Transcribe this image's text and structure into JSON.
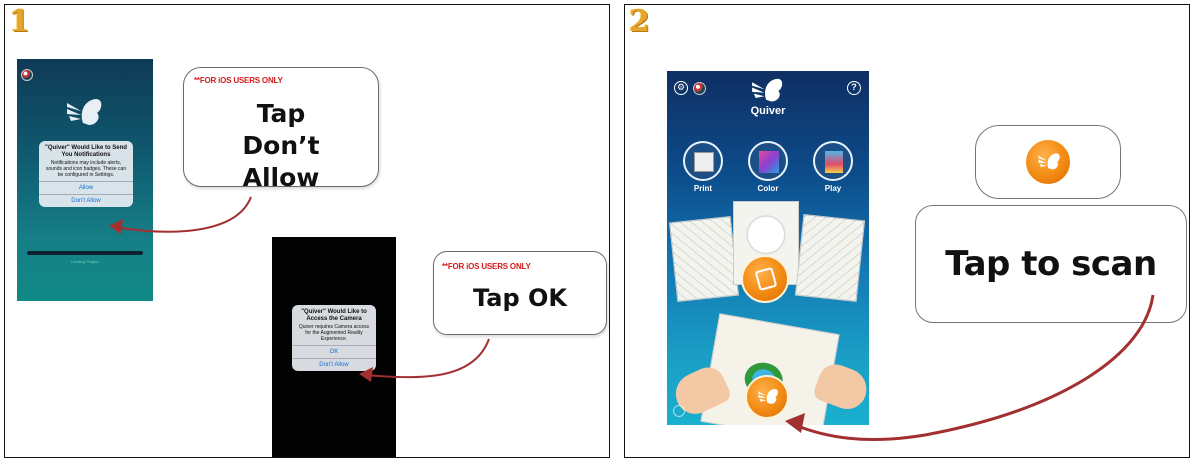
{
  "panel1": {
    "step_number": "1",
    "phone_notification": {
      "dialog_title": "\"Quiver\" Would Like to Send You Notifications",
      "dialog_body": "Notifications may include alerts, sounds and icon badges. These can be configured in Settings.",
      "allow_button": "Allow",
      "dont_allow_button": "Don't Allow",
      "loading_text": "Loading Plugins"
    },
    "callout_notifications": {
      "note": "**FOR iOS USERS ONLY",
      "instruction": "Tap Don’t Allow"
    },
    "phone_camera": {
      "dialog_title": "\"Quiver\" Would Like to Access the Camera",
      "dialog_body": "Quiver requires Camera access for the Augmented Reality Experience.",
      "ok_button": "OK",
      "dont_allow_button": "Don't Allow"
    },
    "callout_camera": {
      "note": "**FOR iOS USERS ONLY",
      "instruction": "Tap OK"
    }
  },
  "panel2": {
    "step_number": "2",
    "app": {
      "app_name": "Quiver",
      "help_symbol": "?",
      "menu": [
        {
          "label": "Print",
          "icon": "printer-icon"
        },
        {
          "label": "Color",
          "icon": "color-palette-icon"
        },
        {
          "label": "Play",
          "icon": "play-card-icon"
        }
      ]
    },
    "callout": {
      "instruction": "Tap to scan"
    }
  },
  "colors": {
    "note_red": "#d41b1b",
    "step_gold": "#e6a52a",
    "arrow_red": "#a23030",
    "scan_orange": "#f28a12"
  }
}
